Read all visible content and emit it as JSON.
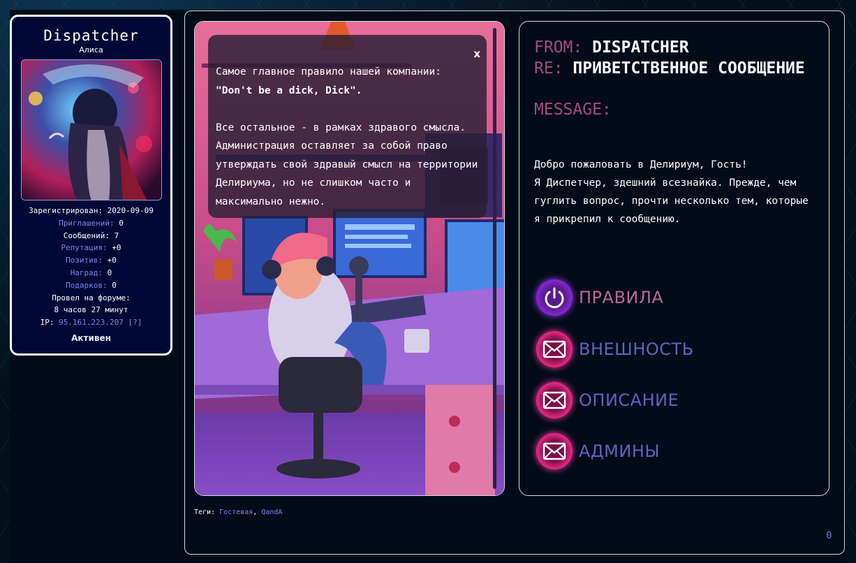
{
  "profile": {
    "name": "Dispatcher",
    "title": "Алиса",
    "registered": "Зарегистрирован: 2020-09-09",
    "invites_label": "Приглашений:",
    "invites_value": " 0",
    "messages": "Сообщений: 7",
    "reputation_label": "Репутация:",
    "reputation_value": " +0",
    "positive_label": "Позитив:",
    "positive_value": " +0",
    "awards_label": "Наград:",
    "awards_value": " 0",
    "gifts_label": "Подарков:",
    "gifts_value": " 0",
    "time_label": "Провел на форуме:",
    "time_value": "8 часов 27 минут",
    "ip_label": "IP: ",
    "ip_value": "95.161.223.207 [?]",
    "status": "Активен"
  },
  "note": {
    "close": "x",
    "line1": "Самое главное правило нашей компании:",
    "line2": "\"Don't be a dick, Dick\".",
    "para2": "Все остальное - в рамках здравого смысла. Администрация оставляет за собой право утверждать свой здравый смысл на территории Делириума, но не слишком часто и максимально нежно."
  },
  "message": {
    "from_label": "FROM:",
    "from_value": "DISPATCHER",
    "re_label": "RE:",
    "re_value": "ПРИВЕТСТВЕННОЕ СООБЩЕНИЕ",
    "message_label": "MESSAGE:",
    "greeting_line1": "Добро пожаловать в Делириум, Гость!",
    "greeting_line2": "Я Диспетчер, здешний всезнайка. Прежде, чем гуглить вопрос, прочти несколько тем, которые я прикрепил к сообщению."
  },
  "menu": [
    {
      "label": "ПРАВИЛА",
      "icon": "power-icon"
    },
    {
      "label": "ВНЕШНОСТЬ",
      "icon": "mail-icon"
    },
    {
      "label": "ОПИСАНИЕ",
      "icon": "mail-icon"
    },
    {
      "label": "АДМИНЫ",
      "icon": "mail-icon"
    }
  ],
  "tags": {
    "label": "Теги: ",
    "tag1": "Гостевая",
    "sep": ", ",
    "tag2": "QandA"
  },
  "counter": "0",
  "colors": {
    "accent_pink": "#a34c7c",
    "link_blue": "#7b86e8",
    "menu_blue": "#5f63c3",
    "neon_pink": "#ff2d94",
    "neon_purple": "#8a2be2"
  }
}
